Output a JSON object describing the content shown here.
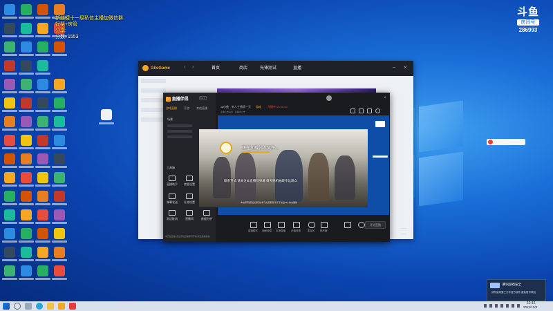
{
  "overlay": {
    "line1": "新丝捷十一级私信主播加微信群",
    "line2": "好帮+房管",
    "line3": "分享:",
    "score": "分数: 1553"
  },
  "douyu": {
    "logo_text": "斗鱼",
    "room_label": "房间号",
    "room_number": "286993"
  },
  "gamebox": {
    "brand": "GileGame",
    "tabs": [
      "首页",
      "商店",
      "先锋测试",
      "直播"
    ]
  },
  "stream_app": {
    "brand": "直播伴侣",
    "version": "5.0.0",
    "left_tabs": [
      "游戏直播",
      "手游",
      "其他直播"
    ],
    "scene_title": "场景",
    "tools_label": "工具箱",
    "tools": [
      "直播助手",
      "房管设置",
      "弹幕发送",
      "礼物设置",
      "测试推流",
      "直播间",
      "数据分析",
      "分享",
      "更多"
    ],
    "bottom_hint": "未开始直播,点击开始直播即可开播,祝您直播愉快",
    "room_title": "斗小鱼",
    "room_subtitle": "新人主播第一天",
    "room_tag": "游戏",
    "room_status": "开播中 00:00:00",
    "announcement": "主播公告设置 · 直播间公告",
    "banner_text": "正在加载脚本文件...",
    "banner_sub": "联系方式:请关注本直播间弹幕 每天随机抽取幸运观众",
    "banner_footer": "本站所有游戏资源仅供学习交流使用 请于下载后24小时内删除",
    "toolbar": [
      "直播模式",
      "画面设置",
      "本地直播",
      "开播设置",
      "麦克风",
      "扬声器",
      "录制",
      "设置"
    ],
    "start_button": "开始直播"
  },
  "notification": {
    "title": "腾讯游戏安全",
    "body": "请勿使用第三方非官方软件,避免账号风险"
  },
  "taskbar": {
    "time": "12:16",
    "date": "2022/12/8"
  },
  "colors": {
    "overlay_yellow": "#ffe94d",
    "accent_orange": "#f5a623",
    "desktop_blue": "#0b44b0"
  }
}
